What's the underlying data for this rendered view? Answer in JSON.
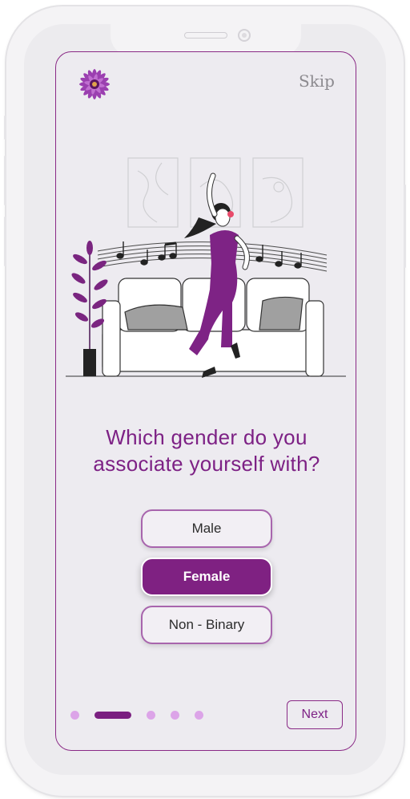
{
  "header": {
    "skip_label": "Skip",
    "logo_icon": "purple-flower-icon"
  },
  "question": {
    "line1": "Which gender do you",
    "line2": "associate yourself with?"
  },
  "options": [
    {
      "label": "Male",
      "selected": false
    },
    {
      "label": "Female",
      "selected": true
    },
    {
      "label": "Non - Binary",
      "selected": false
    }
  ],
  "pager": {
    "total_steps": 5,
    "current_step": 2
  },
  "footer": {
    "next_label": "Next"
  },
  "colors": {
    "accent": "#7f2182",
    "dot_inactive": "#dca4e8",
    "background": "#edebf0"
  }
}
